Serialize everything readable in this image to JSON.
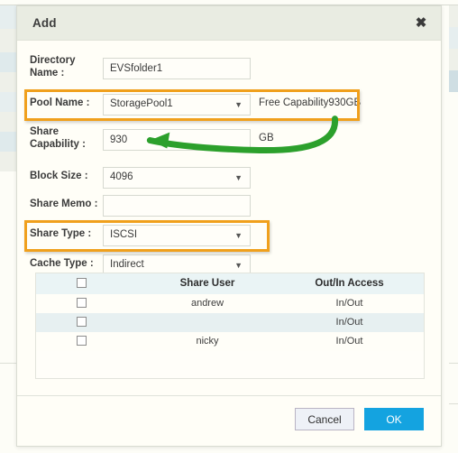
{
  "dialog": {
    "title": "Add",
    "close_icon": "close-icon"
  },
  "form": {
    "fields": [
      {
        "key": "directory_name",
        "label": "Directory\nName :",
        "label_line1": "Directory",
        "label_line2": "Name :",
        "control": "text",
        "value": "EVSfolder1",
        "suffix": ""
      },
      {
        "key": "pool_name",
        "label": "Pool Name :",
        "control": "select",
        "value": "StoragePool1",
        "suffix": "Free Capability930GB",
        "highlighted": true
      },
      {
        "key": "share_capability",
        "label_line1": "Share",
        "label_line2": "Capability :",
        "control": "text",
        "value": "930",
        "suffix": "GB"
      },
      {
        "key": "block_size",
        "label": "Block Size :",
        "control": "select",
        "value": "4096",
        "suffix": ""
      },
      {
        "key": "share_memo",
        "label": "Share Memo :",
        "control": "text",
        "value": "",
        "suffix": ""
      },
      {
        "key": "share_type",
        "label": "Share Type :",
        "control": "select",
        "value": "ISCSI",
        "suffix": "",
        "highlighted": true
      },
      {
        "key": "cache_type",
        "label": "Cache Type :",
        "control": "select",
        "value": "Indirect",
        "suffix": ""
      }
    ],
    "caret_glyph": "▼"
  },
  "share_table": {
    "columns": [
      "",
      "Share User",
      "Out/In Access"
    ],
    "rows": [
      {
        "checked": false,
        "user": "andrew",
        "access": "In/Out"
      },
      {
        "checked": false,
        "user": "",
        "access": "In/Out"
      },
      {
        "checked": false,
        "user": "nicky",
        "access": "In/Out"
      }
    ]
  },
  "footer": {
    "cancel_label": "Cancel",
    "ok_label": "OK"
  },
  "annotations": {
    "highlight_color": "#f0a01c",
    "arrow_color": "#2ca02c",
    "arrow_from": "Free Capability930GB",
    "arrow_to": "930"
  },
  "theme": {
    "header_bg": "#e9ece2",
    "body_bg": "#fffef7",
    "ok_button_bg": "#14a3e0",
    "table_header_bg": "#eaf4f5",
    "table_alt_row_bg": "#e7f0f1"
  }
}
